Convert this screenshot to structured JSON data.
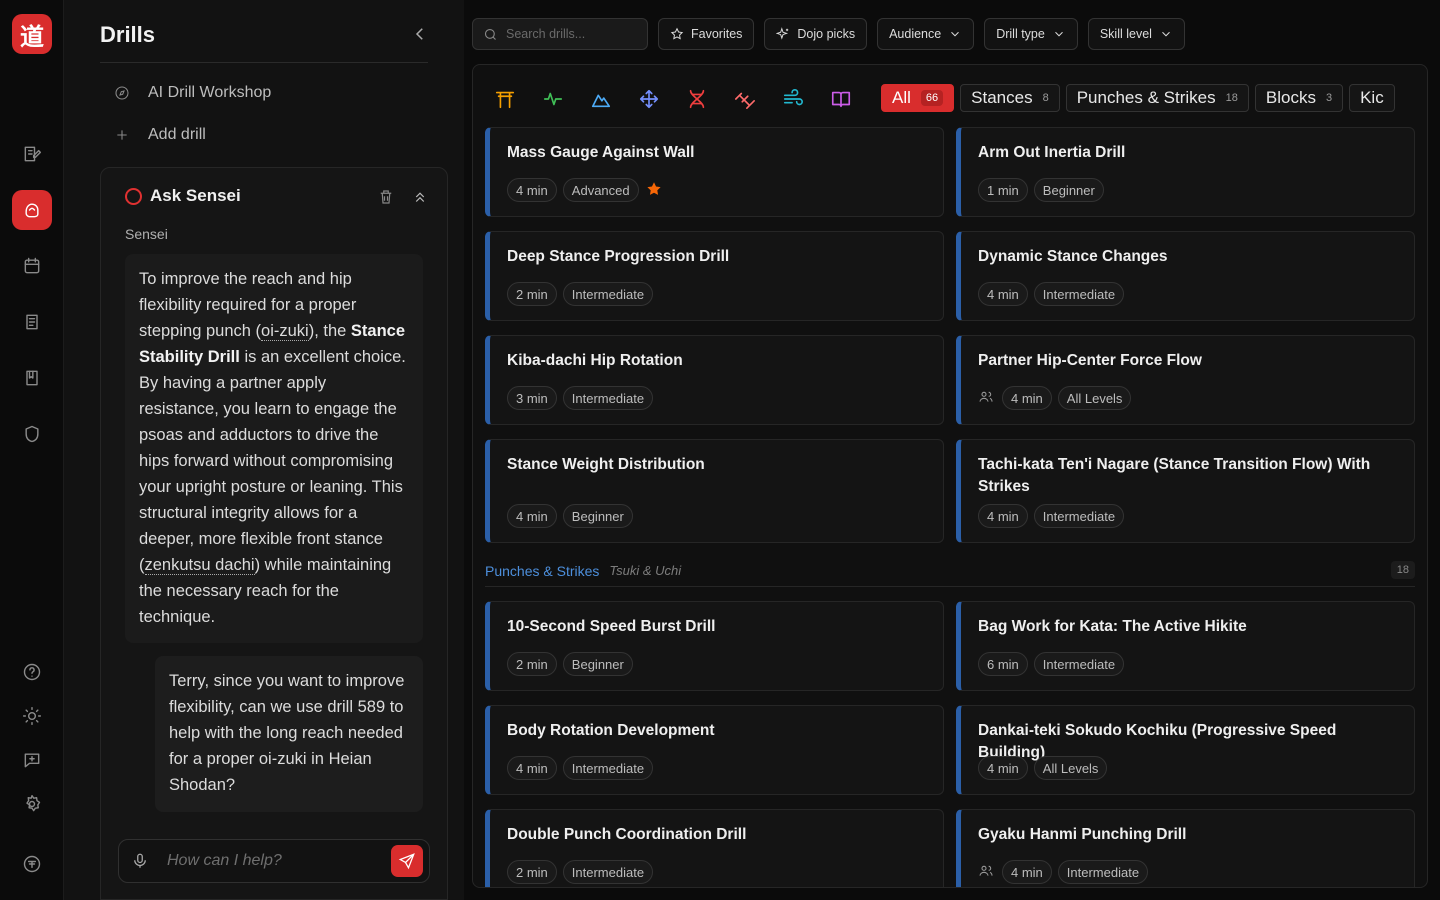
{
  "app": {
    "logo_glyph": "道",
    "accent": "#d92d2d"
  },
  "rail": {
    "items": [
      "journal-icon",
      "drills-icon",
      "calendar-icon",
      "notes-icon",
      "book-icon",
      "shield-icon"
    ],
    "bottom": [
      "help-icon",
      "sun-icon",
      "feedback-icon",
      "settings-icon",
      "profile-icon"
    ]
  },
  "panel": {
    "title": "Drills",
    "ai_workshop": "AI Drill Workshop",
    "add_drill": "Add drill",
    "sensei": {
      "title": "Ask Sensei",
      "label": "Sensei",
      "ai_message": {
        "p1": "To improve the reach and hip flexibility required for a proper stepping punch (",
        "term1": "oi-zuki",
        "p2": "), the ",
        "bold": "Stance Stability Drill",
        "p3": " is an excellent choice. By having a partner apply resistance, you learn to engage the psoas and adductors to drive the hips forward without compromising your upright posture or leaning. This structural integrity allows for a deeper, more flexible front stance (",
        "term2": "zenkutsu dachi",
        "p4": ") while maintaining the necessary reach for the technique."
      },
      "user_message": "Terry, since you want to improve flexibility, can we use drill 589 to help with the long reach needed for a proper oi-zuki in Heian Shodan?",
      "input_placeholder": "How can I help?"
    }
  },
  "toolbar": {
    "search_placeholder": "Search drills...",
    "favorites": "Favorites",
    "dojo_picks": "Dojo picks",
    "audience": "Audience",
    "drill_type": "Drill type",
    "skill_level": "Skill level"
  },
  "categories": {
    "icons": [
      "torii-icon",
      "pulse-icon",
      "mountain-icon",
      "move-icon",
      "dna-icon",
      "dumbbell-icon",
      "wind-icon",
      "open-book-icon"
    ],
    "tabs": [
      {
        "label": "All",
        "count": "66"
      },
      {
        "label": "Stances",
        "count": "8"
      },
      {
        "label": "Punches & Strikes",
        "count": "18"
      },
      {
        "label": "Blocks",
        "count": "3"
      },
      {
        "label": "Kic",
        "count": ""
      }
    ]
  },
  "drills": [
    {
      "title": "Mass Gauge Against Wall",
      "duration": "4 min",
      "level": "Advanced",
      "favorite": true
    },
    {
      "title": "Arm Out Inertia Drill",
      "duration": "1 min",
      "level": "Beginner"
    },
    {
      "title": "Deep Stance Progression Drill",
      "duration": "2 min",
      "level": "Intermediate"
    },
    {
      "title": "Dynamic Stance Changes",
      "duration": "4 min",
      "level": "Intermediate"
    },
    {
      "title": "Kiba-dachi Hip Rotation",
      "duration": "3 min",
      "level": "Intermediate"
    },
    {
      "title": "Partner Hip-Center Force Flow",
      "duration": "4 min",
      "level": "All Levels",
      "partner": true
    },
    {
      "title": "Stance Weight Distribution",
      "duration": "4 min",
      "level": "Beginner"
    },
    {
      "title": "Tachi-kata Ten'i Nagare (Stance Transition Flow) With Strikes",
      "duration": "4 min",
      "level": "Intermediate"
    }
  ],
  "section": {
    "name": "Punches & Strikes",
    "subtitle": "Tsuki & Uchi",
    "count": "18"
  },
  "punch_drills": [
    {
      "title": "10-Second Speed Burst Drill",
      "duration": "2 min",
      "level": "Beginner"
    },
    {
      "title": "Bag Work for Kata: The Active Hikite",
      "duration": "6 min",
      "level": "Intermediate"
    },
    {
      "title": "Body Rotation Development",
      "duration": "4 min",
      "level": "Intermediate"
    },
    {
      "title": "Dankai-teki Sokudo Kochiku (Progressive Speed Building)",
      "duration": "4 min",
      "level": "All Levels"
    },
    {
      "title": "Double Punch Coordination Drill",
      "duration": "2 min",
      "level": "Intermediate"
    },
    {
      "title": "Gyaku Hanmi Punching Drill",
      "duration": "4 min",
      "level": "Intermediate",
      "partner": true
    }
  ]
}
